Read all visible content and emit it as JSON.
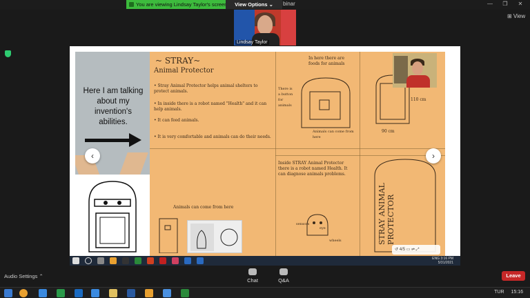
{
  "banner": {
    "text": "You are viewing Lindsay Taylor's screen"
  },
  "view_options": {
    "label": "View Options ⌄"
  },
  "window": {
    "title_fragment": "binar",
    "minimize": "—",
    "restore": "❐",
    "close": "✕"
  },
  "view_button": {
    "label": "⊞ View"
  },
  "speaker": {
    "name": "Lindsay Taylor"
  },
  "slide": {
    "left_text": "Here I am talking about my invention's abilities.",
    "paper_title": "~ STRAY~",
    "paper_subtitle": "Animal Protector",
    "notes": [
      "• Stray Animal Protector helps animal shelters to protect animals.",
      "• In inside there is a robot named \"Health\" and it can help animals.",
      "• It can feed animals.",
      "• It is very comfortable and animals can do their needs."
    ],
    "top_mid_note": "In here there are foods for animals",
    "side_note_1": "There is a button for animals",
    "side_note_2": "Animals can come from here",
    "dims_1": "110 cm",
    "dims_2": "90 cm",
    "inside_note": "Inside STRAY Animal Protector there is a robot named Health. It can diagnose animals problems.",
    "door_note": "Animals can come from here",
    "robot_labels": [
      "sensors",
      "eye",
      "wheels"
    ],
    "vertical_text": "STRAY ANIMAL PROTECTOR"
  },
  "zoom_ctrl": {
    "text": "↺ 4/5 ▭ ⇌ ⤢"
  },
  "inner_tray": {
    "time": "3:16 PM",
    "date": "5/31/2021",
    "lang": "ENG"
  },
  "bottom": {
    "audio_settings": "Audio Settings ⌃",
    "chat": "Chat",
    "qa": "Q&A",
    "leave": "Leave"
  },
  "taskbar": {
    "lang": "TUR",
    "time": "15:16"
  },
  "colors": {
    "banner": "#3dbb3d",
    "leave": "#c62828",
    "paper": "#f2b874"
  }
}
